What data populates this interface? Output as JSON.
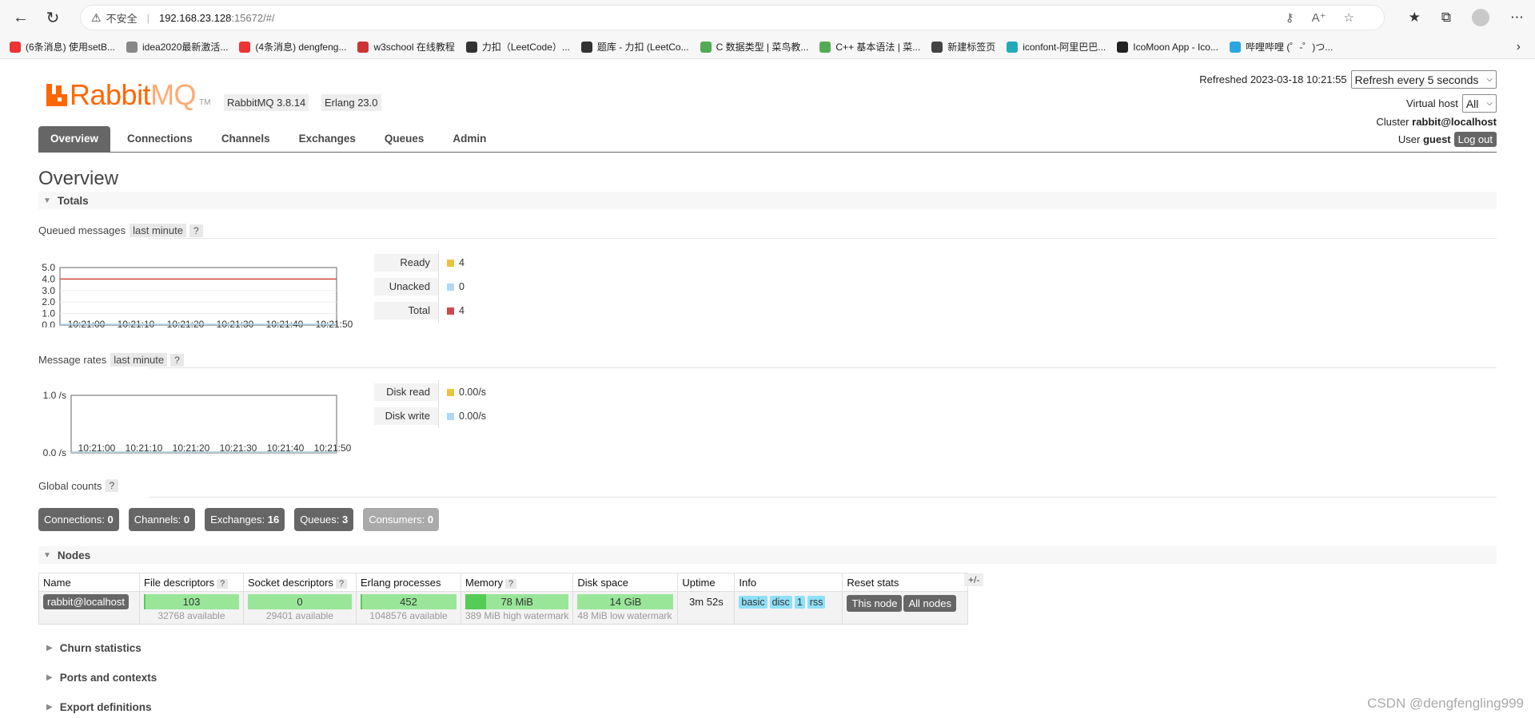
{
  "browser": {
    "not_secure": "不安全",
    "url_host": "192.168.23.128",
    "url_rest": ":15672/#/",
    "bookmarks": [
      {
        "label": "(6条消息) 使用setB...",
        "color": "#e33"
      },
      {
        "label": "idea2020最新激活...",
        "color": "#888"
      },
      {
        "label": "(4条消息) dengfeng...",
        "color": "#e33"
      },
      {
        "label": "w3school 在线教程",
        "color": "#c33"
      },
      {
        "label": "力扣（LeetCode）...",
        "color": "#333"
      },
      {
        "label": "题库 - 力扣 (LeetCo...",
        "color": "#333"
      },
      {
        "label": "C 数据类型 | 菜鸟教...",
        "color": "#5a5"
      },
      {
        "label": "C++ 基本语法 | 菜...",
        "color": "#5a5"
      },
      {
        "label": "新建标签页",
        "color": "#444"
      },
      {
        "label": "iconfont-阿里巴巴...",
        "color": "#2ab"
      },
      {
        "label": "IcoMoon App - Ico...",
        "color": "#222"
      },
      {
        "label": "哔哩哔哩 (゜-゜)つ...",
        "color": "#2aa6e0"
      }
    ]
  },
  "header": {
    "logo_rabbit": "Rabbit",
    "logo_mq": "MQ",
    "logo_tm": "TM",
    "rabbitmq_version": "RabbitMQ 3.8.14",
    "erlang_version": "Erlang 23.0",
    "refreshed": "Refreshed 2023-03-18 10:21:55",
    "refresh_select": "Refresh every 5 seconds",
    "vhost_label": "Virtual host",
    "vhost_select": "All",
    "cluster_label": "Cluster",
    "cluster_name": "rabbit@localhost",
    "user_label": "User",
    "user_name": "guest",
    "logout": "Log out"
  },
  "tabs": [
    {
      "label": "Overview",
      "active": true
    },
    {
      "label": "Connections"
    },
    {
      "label": "Channels"
    },
    {
      "label": "Exchanges"
    },
    {
      "label": "Queues"
    },
    {
      "label": "Admin"
    }
  ],
  "page_title": "Overview",
  "totals": {
    "title": "Totals",
    "queued_label": "Queued messages",
    "queued_range": "last minute",
    "help": "?",
    "rates_label": "Message rates",
    "rates_range": "last minute",
    "global_label": "Global counts"
  },
  "chart_data": [
    {
      "type": "line",
      "x": [
        "10:21:00",
        "10:21:10",
        "10:21:20",
        "10:21:30",
        "10:21:40",
        "10:21:50"
      ],
      "y_ticks": [
        "5.0",
        "4.0",
        "3.0",
        "2.0",
        "1.0",
        "0.0"
      ],
      "ylim": [
        0,
        5
      ],
      "series": [
        {
          "name": "Ready",
          "values": [
            4,
            4,
            4,
            4,
            4,
            4
          ],
          "color": "#edc240",
          "display": "4"
        },
        {
          "name": "Unacked",
          "values": [
            0,
            0,
            0,
            0,
            0,
            0
          ],
          "color": "#afd8f8",
          "display": "0"
        },
        {
          "name": "Total",
          "values": [
            4,
            4,
            4,
            4,
            4,
            4
          ],
          "color": "#cb4b4b",
          "display": "4"
        }
      ]
    },
    {
      "type": "line",
      "x": [
        "10:21:00",
        "10:21:10",
        "10:21:20",
        "10:21:30",
        "10:21:40",
        "10:21:50"
      ],
      "y_ticks": [
        "1.0 /s",
        "0.0 /s"
      ],
      "ylim": [
        0,
        1
      ],
      "series": [
        {
          "name": "Disk read",
          "values": [
            0,
            0,
            0,
            0,
            0,
            0
          ],
          "color": "#edc240",
          "display": "0.00/s"
        },
        {
          "name": "Disk write",
          "values": [
            0,
            0,
            0,
            0,
            0,
            0
          ],
          "color": "#afd8f8",
          "display": "0.00/s"
        }
      ]
    }
  ],
  "global_counts": [
    {
      "label": "Connections:",
      "value": "0"
    },
    {
      "label": "Channels:",
      "value": "0"
    },
    {
      "label": "Exchanges:",
      "value": "16"
    },
    {
      "label": "Queues:",
      "value": "3"
    },
    {
      "label": "Consumers:",
      "value": "0"
    }
  ],
  "nodes": {
    "title": "Nodes",
    "headers": [
      "Name",
      "File descriptors",
      "Socket descriptors",
      "Erlang processes",
      "Memory",
      "Disk space",
      "Uptime",
      "Info",
      "Reset stats"
    ],
    "plus_minus": "+/-",
    "row": {
      "name": "rabbit@localhost",
      "fd": "103",
      "fd_avail": "32768 available",
      "fd_ratio": 0.003,
      "sd": "0",
      "sd_avail": "29401 available",
      "sd_ratio": 0,
      "ep": "452",
      "ep_avail": "1048576 available",
      "ep_ratio": 0.0004,
      "mem": "78 MiB",
      "mem_avail": "389 MiB high watermark",
      "mem_ratio": 0.2,
      "disk": "14 GiB",
      "disk_avail": "48 MiB low watermark",
      "disk_ratio": 0,
      "uptime": "3m 52s",
      "info_tags": [
        "basic",
        "disc",
        "1",
        "rss"
      ],
      "reset_this": "This node",
      "reset_all": "All nodes"
    }
  },
  "collapsed_sections": [
    "Churn statistics",
    "Ports and contexts",
    "Export definitions"
  ],
  "watermark": "CSDN @dengfengling999"
}
